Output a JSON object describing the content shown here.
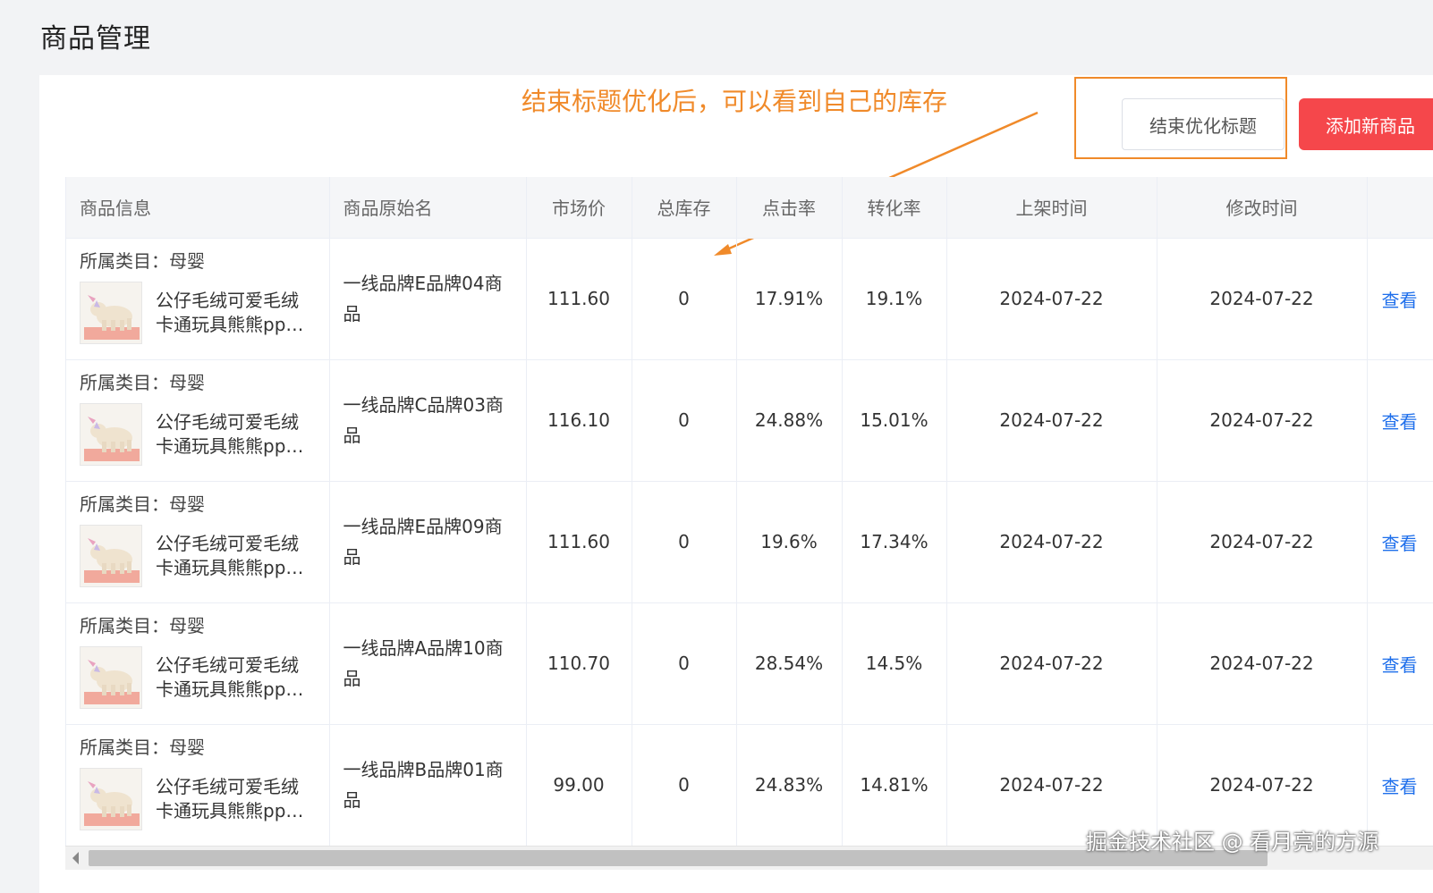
{
  "page": {
    "title": "商品管理"
  },
  "annotation": {
    "text": "结束标题优化后，可以看到自己的库存"
  },
  "toolbar": {
    "end_label": "结束优化标题",
    "add_label": "添加新商品"
  },
  "table": {
    "columns": [
      "商品信息",
      "商品原始名",
      "市场价",
      "总库存",
      "点击率",
      "转化率",
      "上架时间",
      "修改时间",
      ""
    ],
    "rows": [
      {
        "category": "所属类目：母婴",
        "title": "公仔毛绒可爱毛绒卡通玩具熊熊pp棉填充玩偶",
        "original_name": "一线品牌E品牌04商品",
        "price": "111.60",
        "stock": "0",
        "ctr": "17.91%",
        "cvr": "19.1%",
        "listed": "2024-07-22",
        "modified": "2024-07-22",
        "action": "查看"
      },
      {
        "category": "所属类目：母婴",
        "title": "公仔毛绒可爱毛绒卡通玩具熊熊pp棉填充玩偶",
        "original_name": "一线品牌C品牌03商品",
        "price": "116.10",
        "stock": "0",
        "ctr": "24.88%",
        "cvr": "15.01%",
        "listed": "2024-07-22",
        "modified": "2024-07-22",
        "action": "查看"
      },
      {
        "category": "所属类目：母婴",
        "title": "公仔毛绒可爱毛绒卡通玩具熊熊pp棉填充玩偶",
        "original_name": "一线品牌E品牌09商品",
        "price": "111.60",
        "stock": "0",
        "ctr": "19.6%",
        "cvr": "17.34%",
        "listed": "2024-07-22",
        "modified": "2024-07-22",
        "action": "查看"
      },
      {
        "category": "所属类目：母婴",
        "title": "公仔毛绒可爱毛绒卡通玩具熊熊pp棉填充玩偶",
        "original_name": "一线品牌A品牌10商品",
        "price": "110.70",
        "stock": "0",
        "ctr": "28.54%",
        "cvr": "14.5%",
        "listed": "2024-07-22",
        "modified": "2024-07-22",
        "action": "查看"
      },
      {
        "category": "所属类目：母婴",
        "title": "公仔毛绒可爱毛绒卡通玩具熊熊pp棉填充玩偶",
        "original_name": "一线品牌B品牌01商品",
        "price": "99.00",
        "stock": "0",
        "ctr": "24.83%",
        "cvr": "14.81%",
        "listed": "2024-07-22",
        "modified": "2024-07-22",
        "action": "查看"
      }
    ]
  },
  "watermark": "掘金技术社区 @ 看月亮的方源",
  "colors": {
    "accent": "#f5474b",
    "annotation": "#f08a2a",
    "link": "#1f6feb"
  }
}
